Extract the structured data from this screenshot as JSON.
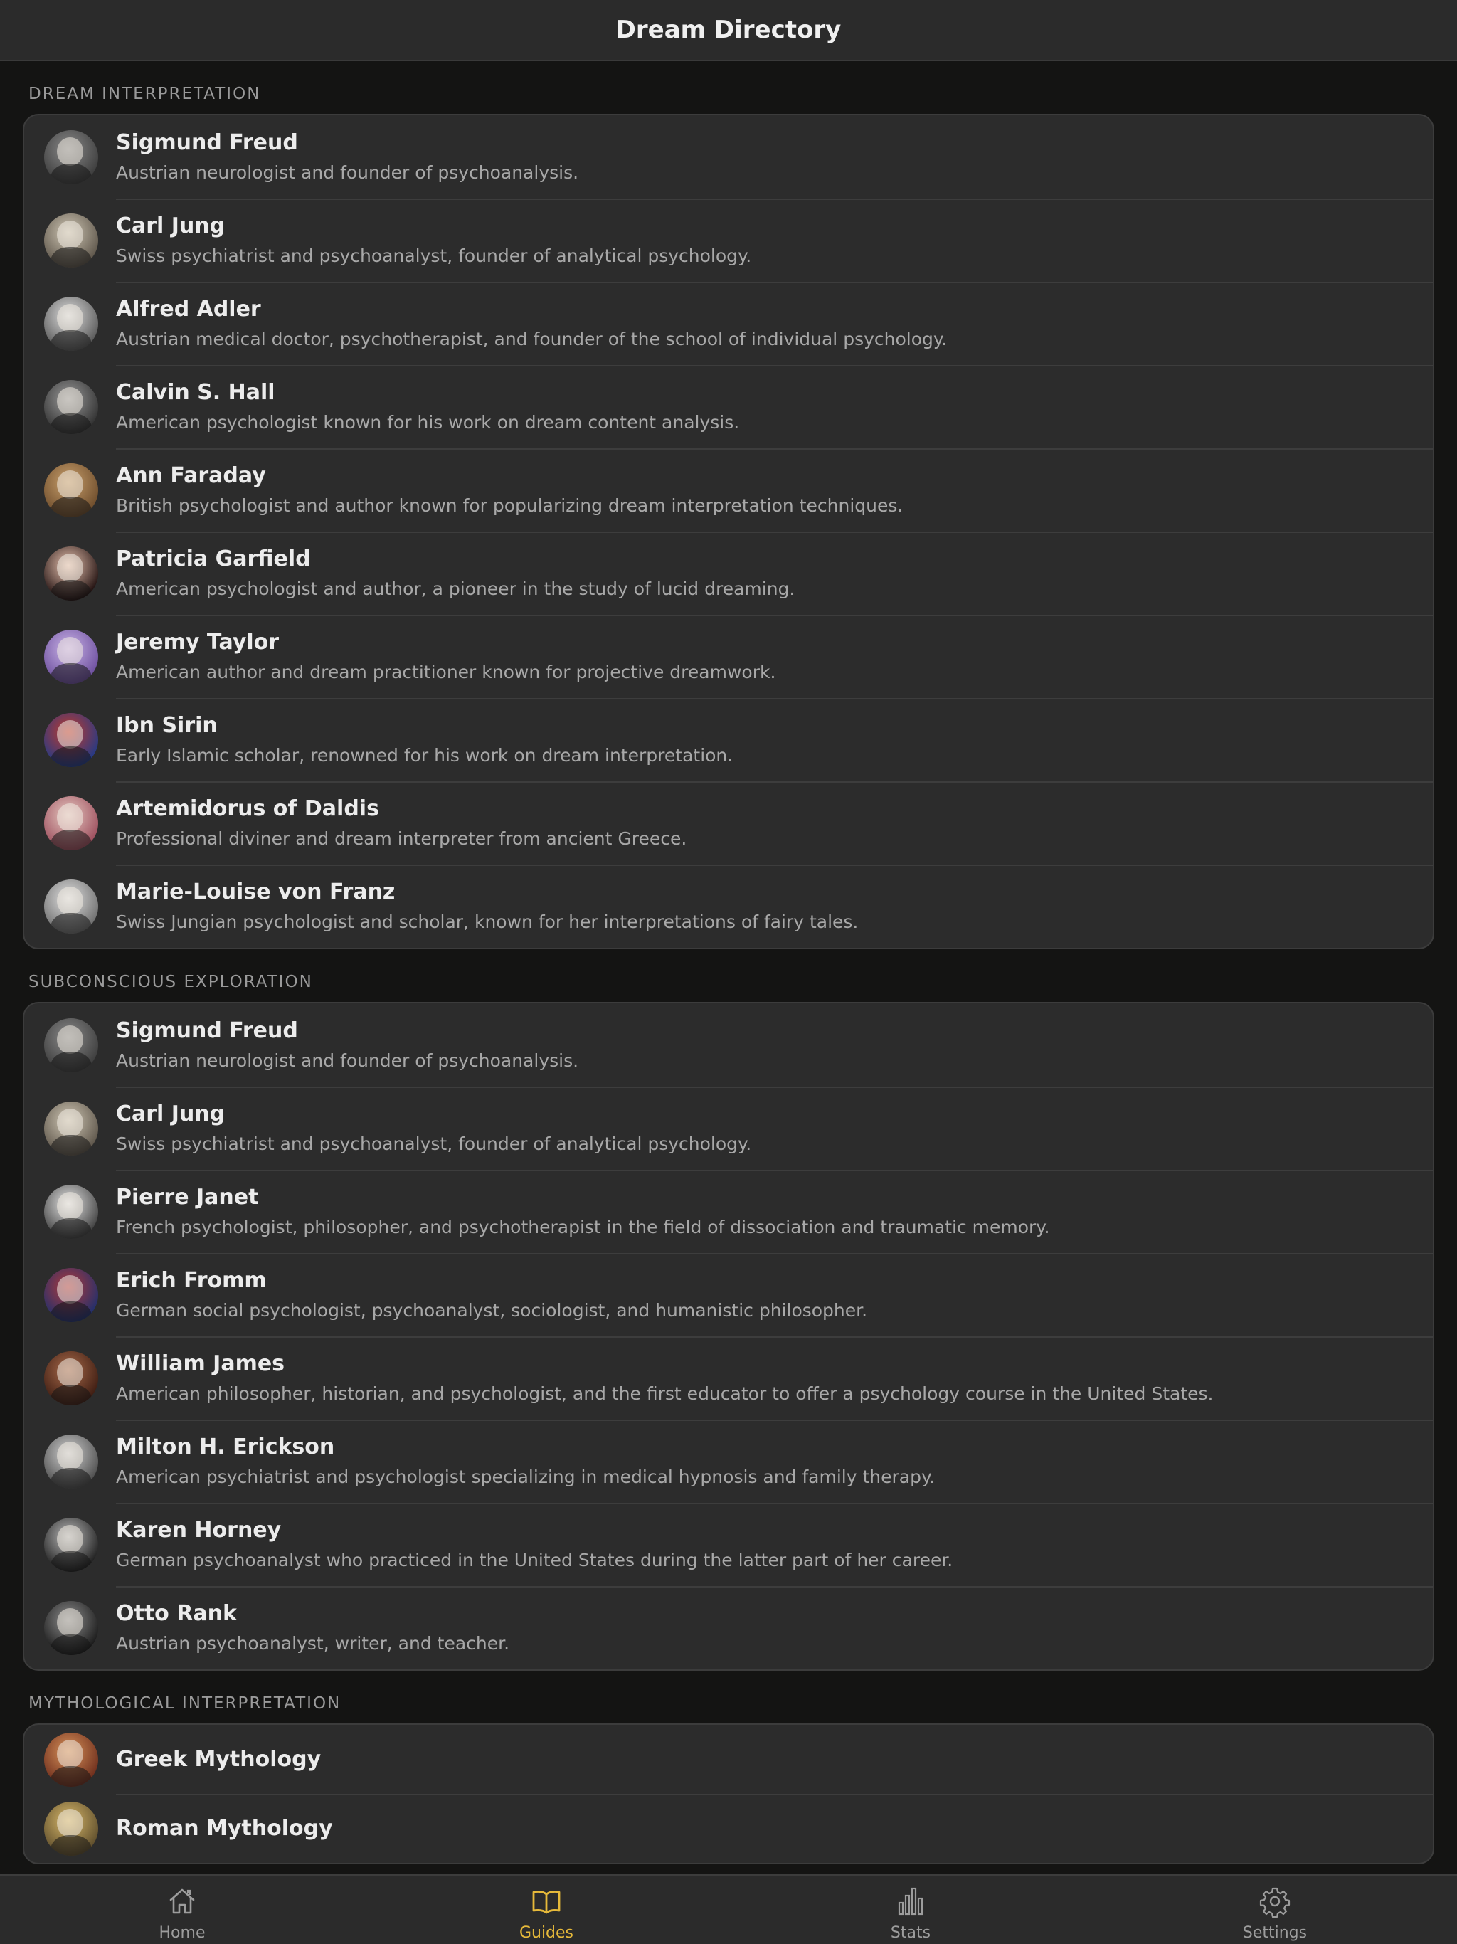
{
  "navbar": {
    "title": "Dream Directory"
  },
  "colors": {
    "accent": "#e6b93a",
    "background": "#141413",
    "card": "#2c2c2c",
    "inactive": "#9d9d9d"
  },
  "sections": [
    {
      "header": "DREAM INTERPRETATION",
      "items": [
        {
          "name": "Sigmund Freud",
          "desc": "Austrian neurologist and founder of psychoanalysis.",
          "avatar": [
            "#8a8a8a",
            "#3a3a3a"
          ]
        },
        {
          "name": "Carl Jung",
          "desc": "Swiss psychiatrist and psychoanalyst, founder of analytical psychology.",
          "avatar": [
            "#cfc6b4",
            "#5a5247"
          ]
        },
        {
          "name": "Alfred Adler",
          "desc": "Austrian medical doctor, psychotherapist, and founder of the school of individual psychology.",
          "avatar": [
            "#dcdcdc",
            "#555555"
          ]
        },
        {
          "name": "Calvin S. Hall",
          "desc": "American psychologist known for his work on dream content analysis.",
          "avatar": [
            "#9a9a9a",
            "#2e2e2e"
          ]
        },
        {
          "name": "Ann Faraday",
          "desc": "British psychologist and author known for popularizing dream interpretation techniques.",
          "avatar": [
            "#c9a06c",
            "#6b4a2a"
          ]
        },
        {
          "name": "Patricia Garfield",
          "desc": "American psychologist and author, a pioneer in the study of lucid dreaming.",
          "avatar": [
            "#e8c3b0",
            "#1a0a0a"
          ]
        },
        {
          "name": "Jeremy Taylor",
          "desc": "American author and dream practitioner known for projective dreamwork.",
          "avatar": [
            "#c9b3e6",
            "#6a4c9c"
          ]
        },
        {
          "name": "Ibn Sirin",
          "desc": "Early Islamic scholar, renowned for his work on dream interpretation.",
          "avatar": [
            "#c23a2a",
            "#1e3a8a"
          ]
        },
        {
          "name": "Artemidorus of Daldis",
          "desc": "Professional diviner and dream interpreter from ancient Greece.",
          "avatar": [
            "#e6c8c0",
            "#9a4a5a"
          ]
        },
        {
          "name": "Marie-Louise von Franz",
          "desc": "Swiss Jungian psychologist and scholar, known for her interpretations of fairy tales.",
          "avatar": [
            "#e0e0e0",
            "#6a6a6a"
          ]
        }
      ]
    },
    {
      "header": "SUBCONSCIOUS EXPLORATION",
      "items": [
        {
          "name": "Sigmund Freud",
          "desc": "Austrian neurologist and founder of psychoanalysis.",
          "avatar": [
            "#8a8a8a",
            "#3a3a3a"
          ]
        },
        {
          "name": "Carl Jung",
          "desc": "Swiss psychiatrist and psychoanalyst, founder of analytical psychology.",
          "avatar": [
            "#cfc6b4",
            "#5a5247"
          ]
        },
        {
          "name": "Pierre Janet",
          "desc": "French psychologist, philosopher, and psychotherapist in the field of dissociation and traumatic memory.",
          "avatar": [
            "#e4e4e4",
            "#3c3c3c"
          ]
        },
        {
          "name": "Erich Fromm",
          "desc": "German social psychologist, psychoanalyst, sociologist, and humanistic philosopher.",
          "avatar": [
            "#b03a3a",
            "#1c2f6e"
          ]
        },
        {
          "name": "William James",
          "desc": "American philosopher, historian, and psychologist, and the first educator to offer a psychology course in the United States.",
          "avatar": [
            "#a86a4a",
            "#3a1a10"
          ]
        },
        {
          "name": "Milton H. Erickson",
          "desc": "American psychiatrist and psychologist specializing in medical hypnosis and family therapy.",
          "avatar": [
            "#cfcfcf",
            "#4a4a4a"
          ]
        },
        {
          "name": "Karen Horney",
          "desc": "German psychoanalyst who practiced in the United States during the latter part of her career.",
          "avatar": [
            "#b8b8b8",
            "#1a1a1a"
          ]
        },
        {
          "name": "Otto Rank",
          "desc": "Austrian psychoanalyst, writer, and teacher.",
          "avatar": [
            "#8e8e8e",
            "#161616"
          ]
        }
      ]
    },
    {
      "header": "MYTHOLOGICAL INTERPRETATION",
      "items": [
        {
          "name": "Greek Mythology",
          "desc": "",
          "avatar": [
            "#d8925a",
            "#6a2a1a"
          ]
        },
        {
          "name": "Roman Mythology",
          "desc": "",
          "avatar": [
            "#d8b86a",
            "#5a4a2a"
          ]
        }
      ]
    }
  ],
  "tabs": [
    {
      "label": "Home",
      "icon": "home-icon",
      "active": false
    },
    {
      "label": "Guides",
      "icon": "book-icon",
      "active": true
    },
    {
      "label": "Stats",
      "icon": "bar-chart-icon",
      "active": false
    },
    {
      "label": "Settings",
      "icon": "gear-icon",
      "active": false
    }
  ]
}
